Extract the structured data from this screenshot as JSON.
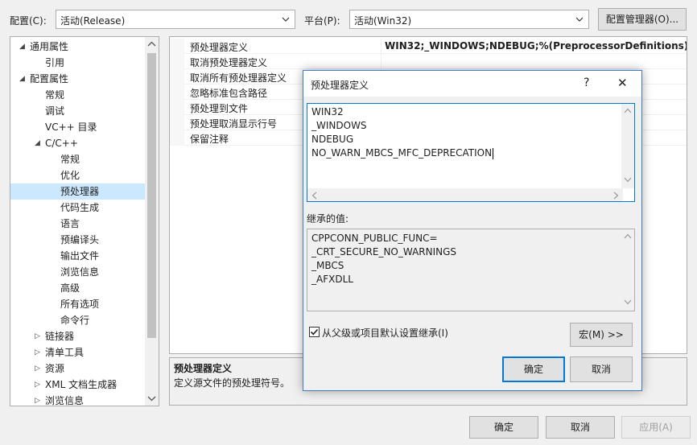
{
  "toolbar": {
    "config_label": "配置(C):",
    "config_value": "活动(Release)",
    "platform_label": "平台(P):",
    "platform_value": "活动(Win32)",
    "config_manager_button": "配置管理器(O)..."
  },
  "tree": {
    "items": [
      {
        "label": "通用属性",
        "expander": "◢",
        "level": 1
      },
      {
        "label": "引用",
        "level": 2
      },
      {
        "label": "配置属性",
        "expander": "◢",
        "level": 1
      },
      {
        "label": "常规",
        "level": 2
      },
      {
        "label": "调试",
        "level": 2
      },
      {
        "label": "VC++ 目录",
        "level": 2
      },
      {
        "label": "C/C++",
        "expander": "◢",
        "level": 2
      },
      {
        "label": "常规",
        "level": 3
      },
      {
        "label": "优化",
        "level": 3
      },
      {
        "label": "预处理器",
        "level": 3,
        "selected": true
      },
      {
        "label": "代码生成",
        "level": 3
      },
      {
        "label": "语言",
        "level": 3
      },
      {
        "label": "预编译头",
        "level": 3
      },
      {
        "label": "输出文件",
        "level": 3
      },
      {
        "label": "浏览信息",
        "level": 3
      },
      {
        "label": "高级",
        "level": 3
      },
      {
        "label": "所有选项",
        "level": 3
      },
      {
        "label": "命令行",
        "level": 3
      },
      {
        "label": "链接器",
        "expander": "▷",
        "level": 2
      },
      {
        "label": "清单工具",
        "expander": "▷",
        "level": 2
      },
      {
        "label": "资源",
        "expander": "▷",
        "level": 2
      },
      {
        "label": "XML 文档生成器",
        "expander": "▷",
        "level": 2
      },
      {
        "label": "浏览信息",
        "expander": "▷",
        "level": 2
      }
    ]
  },
  "properties": {
    "rows": [
      {
        "name": "预处理器定义",
        "value": "WIN32;_WINDOWS;NDEBUG;%(PreprocessorDefinitions)"
      },
      {
        "name": "取消预处理器定义",
        "value": ""
      },
      {
        "name": "取消所有预处理器定义",
        "value": ""
      },
      {
        "name": "忽略标准包含路径",
        "value": ""
      },
      {
        "name": "预处理到文件",
        "value": ""
      },
      {
        "name": "预处理取消显示行号",
        "value": ""
      },
      {
        "name": "保留注释",
        "value": ""
      }
    ]
  },
  "description": {
    "title": "预处理器定义",
    "text": "定义源文件的预处理符号。"
  },
  "dialog": {
    "title": "预处理器定义",
    "help_glyph": "?",
    "close_glyph": "✕",
    "definitions": [
      "WIN32",
      "_WINDOWS",
      "NDEBUG",
      "NO_WARN_MBCS_MFC_DEPRECATION"
    ],
    "inherited_label": "继承的值:",
    "inherited_values": [
      "CPPCONN_PUBLIC_FUNC=",
      "_CRT_SECURE_NO_WARNINGS",
      "_MBCS",
      "_AFXDLL"
    ],
    "inherit_checkbox_label": "从父级或项目默认设置继承(I)",
    "inherit_checked": true,
    "macro_button": "宏(M) >>",
    "ok_button": "确定",
    "cancel_button": "取消"
  },
  "footer": {
    "ok_button": "确定",
    "cancel_button": "取消",
    "apply_button": "应用(A)"
  },
  "colors": {
    "selection": "#cce8ff",
    "accent": "#0078d7",
    "dialog_border": "#3d7cc9"
  }
}
